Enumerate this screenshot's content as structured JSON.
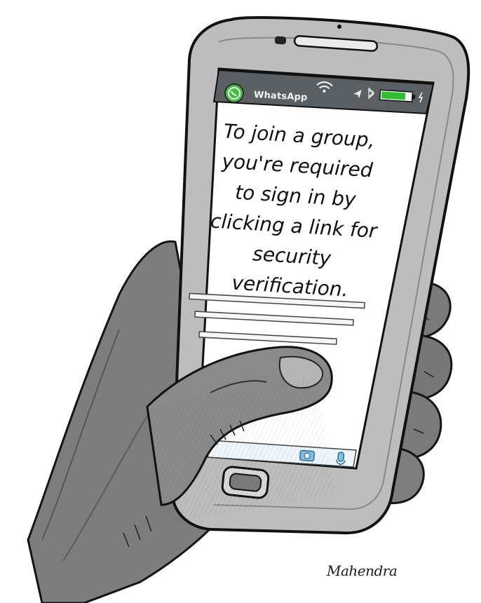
{
  "status_bar": {
    "app_icon": "whatsapp-logo-icon",
    "app_name": "WhatsApp",
    "icons": [
      "wifi-icon",
      "location-arrow-icon",
      "bluetooth-icon",
      "battery-icon",
      "charging-icon"
    ],
    "battery_level": 0.8
  },
  "message": {
    "lines": [
      "To join a group,",
      "you're required",
      "to sign in by",
      "clicking a link for",
      "security",
      "verification."
    ]
  },
  "nav_bar": {
    "icons": [
      "camera-icon",
      "microphone-icon"
    ]
  },
  "signature": "Mahendra",
  "colors": {
    "whatsapp_green": "#3fbf3f",
    "battery_green": "#2ec02e",
    "status_bar": "#5a5f63",
    "nav_bar_blue": "#7fc0e6",
    "ink": "#141414"
  }
}
